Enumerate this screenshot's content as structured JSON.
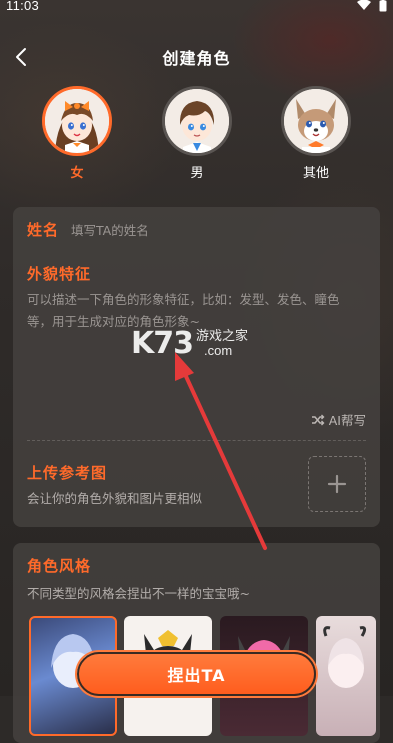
{
  "status_bar": {
    "time": "11:03"
  },
  "header": {
    "title": "创建角色",
    "back_icon": "chevron-left-icon"
  },
  "avatars": [
    {
      "label": "女",
      "selected": true
    },
    {
      "label": "男",
      "selected": false
    },
    {
      "label": "其他",
      "selected": false
    }
  ],
  "form": {
    "name_label": "姓名",
    "name_placeholder": "填写TA的姓名",
    "appearance_label": "外貌特征",
    "appearance_placeholder": "可以描述一下角色的形象特征，比如：发型、发色、瞳色等，用于生成对应的角色形象~",
    "ai_write_label": "AI帮写",
    "upload_label": "上传参考图",
    "upload_hint": "会让你的角色外貌和图片更相似"
  },
  "style": {
    "title": "角色风格",
    "subtitle": "不同类型的风格会捏出不一样的宝宝哦~"
  },
  "submit": {
    "label": "捏出TA"
  },
  "watermark": {
    "brand": "K73",
    "site_cn": "游戏之家",
    "site_domain": ".com"
  },
  "colors": {
    "accent": "#ff6a2a",
    "annotation_arrow": "#e53a3a"
  }
}
